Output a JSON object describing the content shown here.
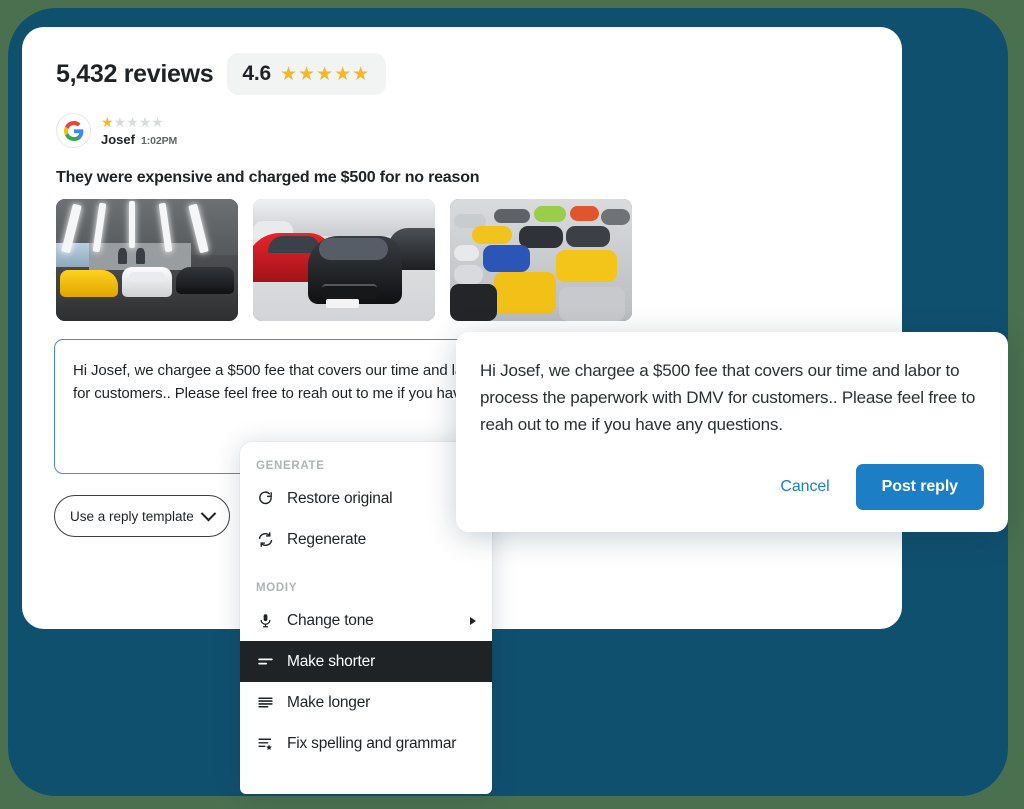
{
  "theme": {
    "page_background": "#4a7050",
    "frame_color": "#10506f",
    "accent_blue": "#1c7ec4",
    "star_gold": "#f5b724",
    "menu_highlight": "#1f2326"
  },
  "review": {
    "reviews_count_label": "5,432 reviews",
    "rating_value": "4.6",
    "rating_stars_filled": 5,
    "rating_stars_total": 5,
    "source_icon": "google-logo-icon",
    "reviewer_stars_filled": 1,
    "reviewer_stars_total": 5,
    "reviewer_name": "Josef",
    "review_time": "1:02PM",
    "review_body": "They were expensive and charged me $500 for no reason",
    "photos": [
      {
        "alt": "showroom-supercars-yellow-white-black"
      },
      {
        "alt": "showroom-red-audi-and-black-audi-suv"
      },
      {
        "alt": "warehouse-of-colorful-supercars"
      }
    ]
  },
  "reply_editor": {
    "draft_text": "Hi Josef, we chargee a $500 fee that covers our time and labor to process the paperwork with DMV for customers.. Please feel free to reah out to me if you have any questions.",
    "template_button_label": "Use a reply template",
    "template_button_icon": "chevron-down-icon"
  },
  "context_menu": {
    "sections": [
      {
        "title": "GENERATE",
        "items": [
          {
            "label": "Restore original",
            "icon": "restore-icon",
            "active": false,
            "has_submenu": false
          },
          {
            "label": "Regenerate",
            "icon": "regenerate-icon",
            "active": false,
            "has_submenu": false
          }
        ]
      },
      {
        "title": "MODIY",
        "items": [
          {
            "label": "Change tone",
            "icon": "microphone-icon",
            "active": false,
            "has_submenu": true
          },
          {
            "label": "Make shorter",
            "icon": "make-shorter-icon",
            "active": true,
            "has_submenu": false
          },
          {
            "label": "Make longer",
            "icon": "make-longer-icon",
            "active": false,
            "has_submenu": false
          },
          {
            "label": "Fix spelling and grammar",
            "icon": "spellcheck-icon",
            "active": false,
            "has_submenu": false
          }
        ]
      }
    ]
  },
  "preview_card": {
    "body_text": "Hi Josef, we chargee a $500 fee that covers our time and labor to process the paperwork with DMV for customers.. Please feel free to reah out to me if you have any questions.",
    "cancel_label": "Cancel",
    "post_label": "Post reply"
  }
}
